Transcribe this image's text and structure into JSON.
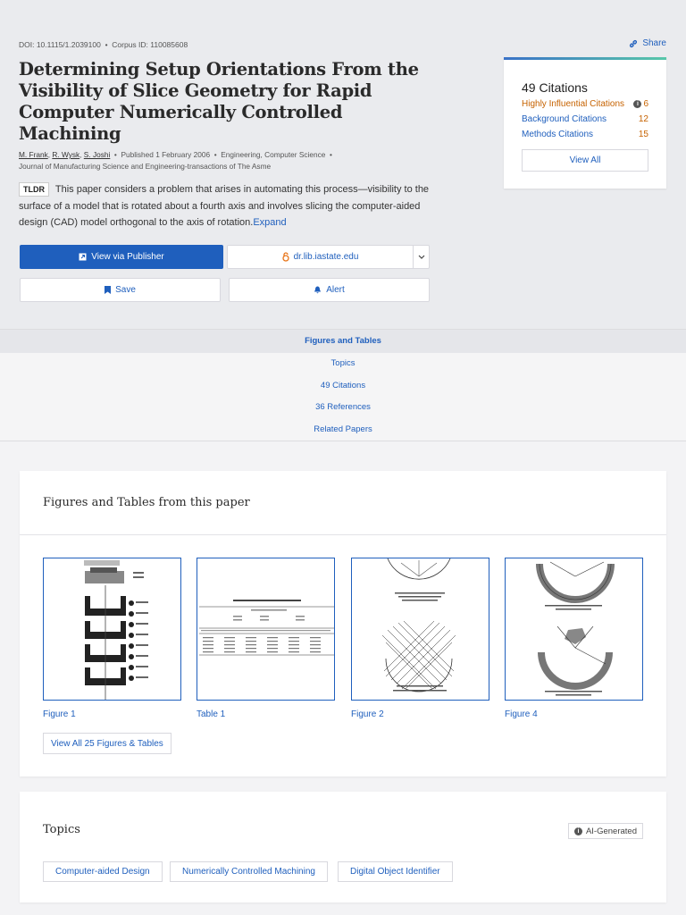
{
  "header": {
    "doi": "DOI: 10.1115/1.2039100",
    "corpus_id": "Corpus ID: 110085608",
    "share_label": "Share"
  },
  "paper": {
    "title": "Determining Setup Orientations From the Visibility of Slice Geometry for Rapid Computer Numerically Controlled Machining",
    "authors": [
      "M. Frank",
      "R. Wysk",
      "S. Joshi"
    ],
    "published": "Published 1 February 2006",
    "fields": "Engineering, Computer Science",
    "journal": "Journal of Manufacturing Science and Engineering-transactions of The Asme",
    "tldr_badge": "TLDR",
    "tldr_text": "This paper considers a problem that arises in automating this process—visibility to the surface of a model that is rotated about a fourth axis and involves slicing the computer-aided design (CAD) model orthogonal to the axis of rotation.",
    "expand_label": "Expand"
  },
  "actions": {
    "view_publisher": "View via Publisher",
    "source_link": "dr.lib.iastate.edu",
    "save": "Save",
    "alert": "Alert"
  },
  "citations_card": {
    "title": "49 Citations",
    "rows": [
      {
        "label": "Highly Influential Citations",
        "value": "6"
      },
      {
        "label": "Background Citations",
        "value": "12"
      },
      {
        "label": "Methods Citations",
        "value": "15"
      }
    ],
    "view_all": "View All"
  },
  "nav": [
    "Figures and Tables",
    "Topics",
    "49 Citations",
    "36 References",
    "Related Papers"
  ],
  "figures_section": {
    "title": "Figures and Tables from this paper",
    "items": [
      "Figure 1",
      "Table 1",
      "Figure 2",
      "Figure 4"
    ],
    "view_all": "View All 25 Figures & Tables"
  },
  "topics_section": {
    "title": "Topics",
    "ai_badge": "AI-Generated",
    "tags": [
      "Computer-aided Design",
      "Numerically Controlled Machining",
      "Digital Object Identifier"
    ]
  },
  "colors": {
    "accent": "#1f5fbd",
    "highlight": "#c66200",
    "hero_bg": "#eaebee"
  }
}
